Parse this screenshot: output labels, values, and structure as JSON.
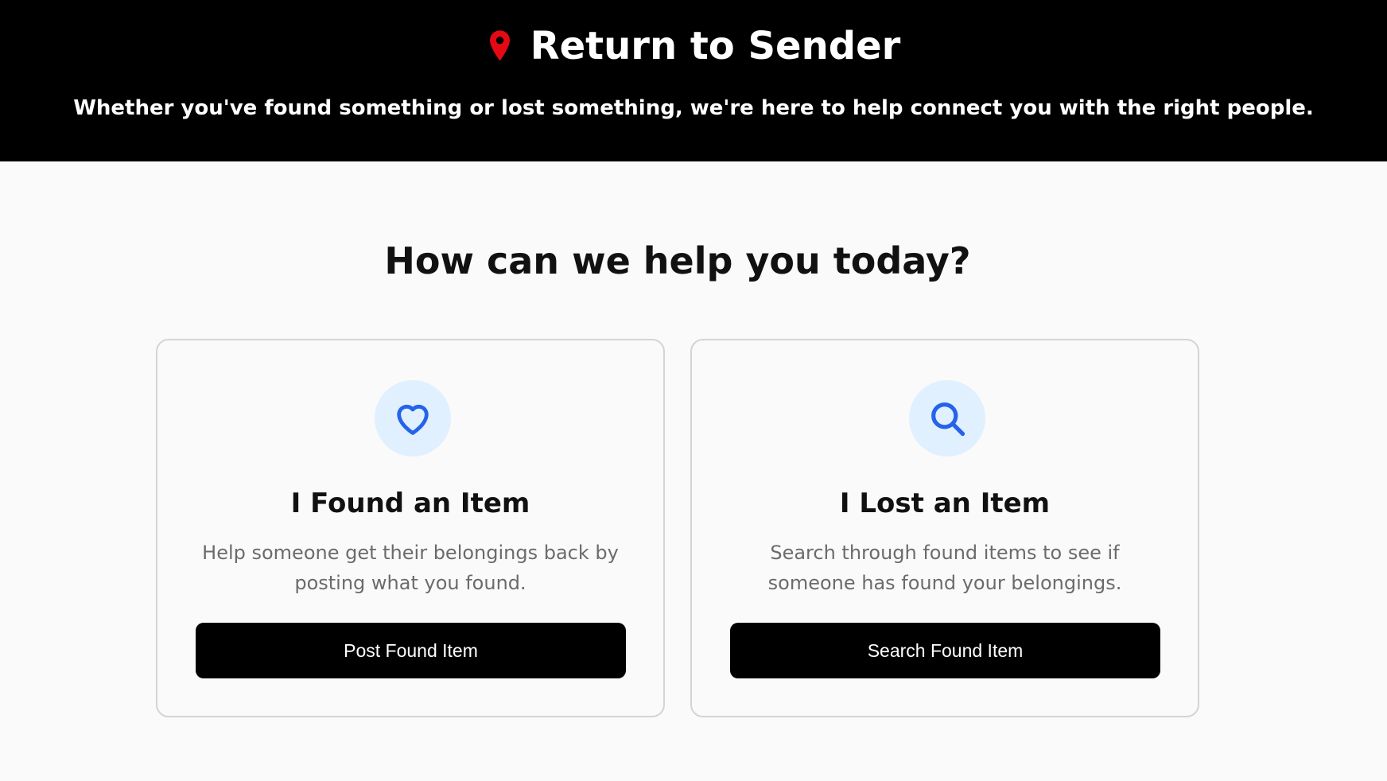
{
  "header": {
    "title": "Return to Sender",
    "tagline": "Whether you've found something or lost something, we're here to help connect you with the right people.",
    "logo_icon": "map-pin-icon",
    "logo_color": "#e50914",
    "background": "#000000"
  },
  "main": {
    "heading": "How can we help you today?"
  },
  "cards": [
    {
      "icon": "heart-icon",
      "title": "I Found an Item",
      "description": "Help someone get their belongings back by posting what you found.",
      "button_label": "Post Found Item"
    },
    {
      "icon": "search-icon",
      "title": "I Lost an Item",
      "description": "Search through found items to see if someone has found your belongings.",
      "button_label": "Search Found Item"
    }
  ],
  "colors": {
    "icon_accent": "#2563eb",
    "icon_background": "#e0f0fe",
    "button_background": "#000000"
  }
}
